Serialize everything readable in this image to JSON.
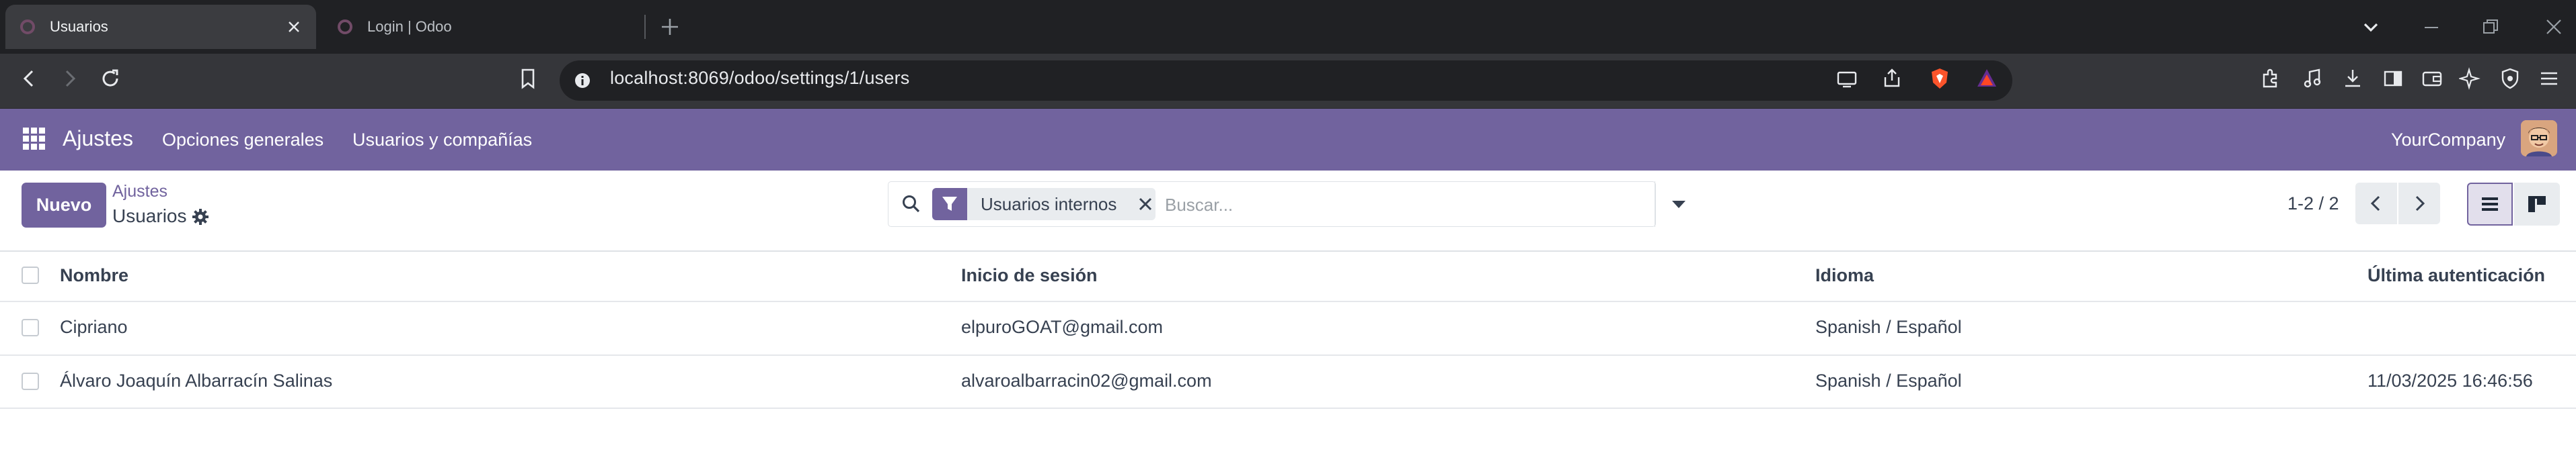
{
  "browser": {
    "tabs": [
      {
        "title": "Usuarios",
        "active": true
      },
      {
        "title": "Login | Odoo",
        "active": false
      }
    ],
    "url": "localhost:8069/odoo/settings/1/users"
  },
  "navbar": {
    "app_name": "Ajustes",
    "menu_items": [
      "Opciones generales",
      "Usuarios y compañías"
    ],
    "company": "YourCompany"
  },
  "control_panel": {
    "new_button": "Nuevo",
    "breadcrumb_parent": "Ajustes",
    "breadcrumb_current": "Usuarios",
    "facet_label": "Usuarios internos",
    "search_placeholder": "Buscar...",
    "pager": "1-2 / 2"
  },
  "table": {
    "columns": [
      "Nombre",
      "Inicio de sesión",
      "Idioma",
      "Última autenticación"
    ],
    "rows": [
      {
        "name": "Cipriano",
        "login": "elpuroGOAT@gmail.com",
        "language": "Spanish / Español",
        "last_auth": ""
      },
      {
        "name": "Álvaro Joaquín Albarracín Salinas",
        "login": "alvaroalbarracin02@gmail.com",
        "language": "Spanish / Español",
        "last_auth": "11/03/2025 16:46:56"
      }
    ]
  },
  "colors": {
    "brand": "#71639e",
    "tabstrip": "#202124",
    "toolbar": "#35363a"
  }
}
